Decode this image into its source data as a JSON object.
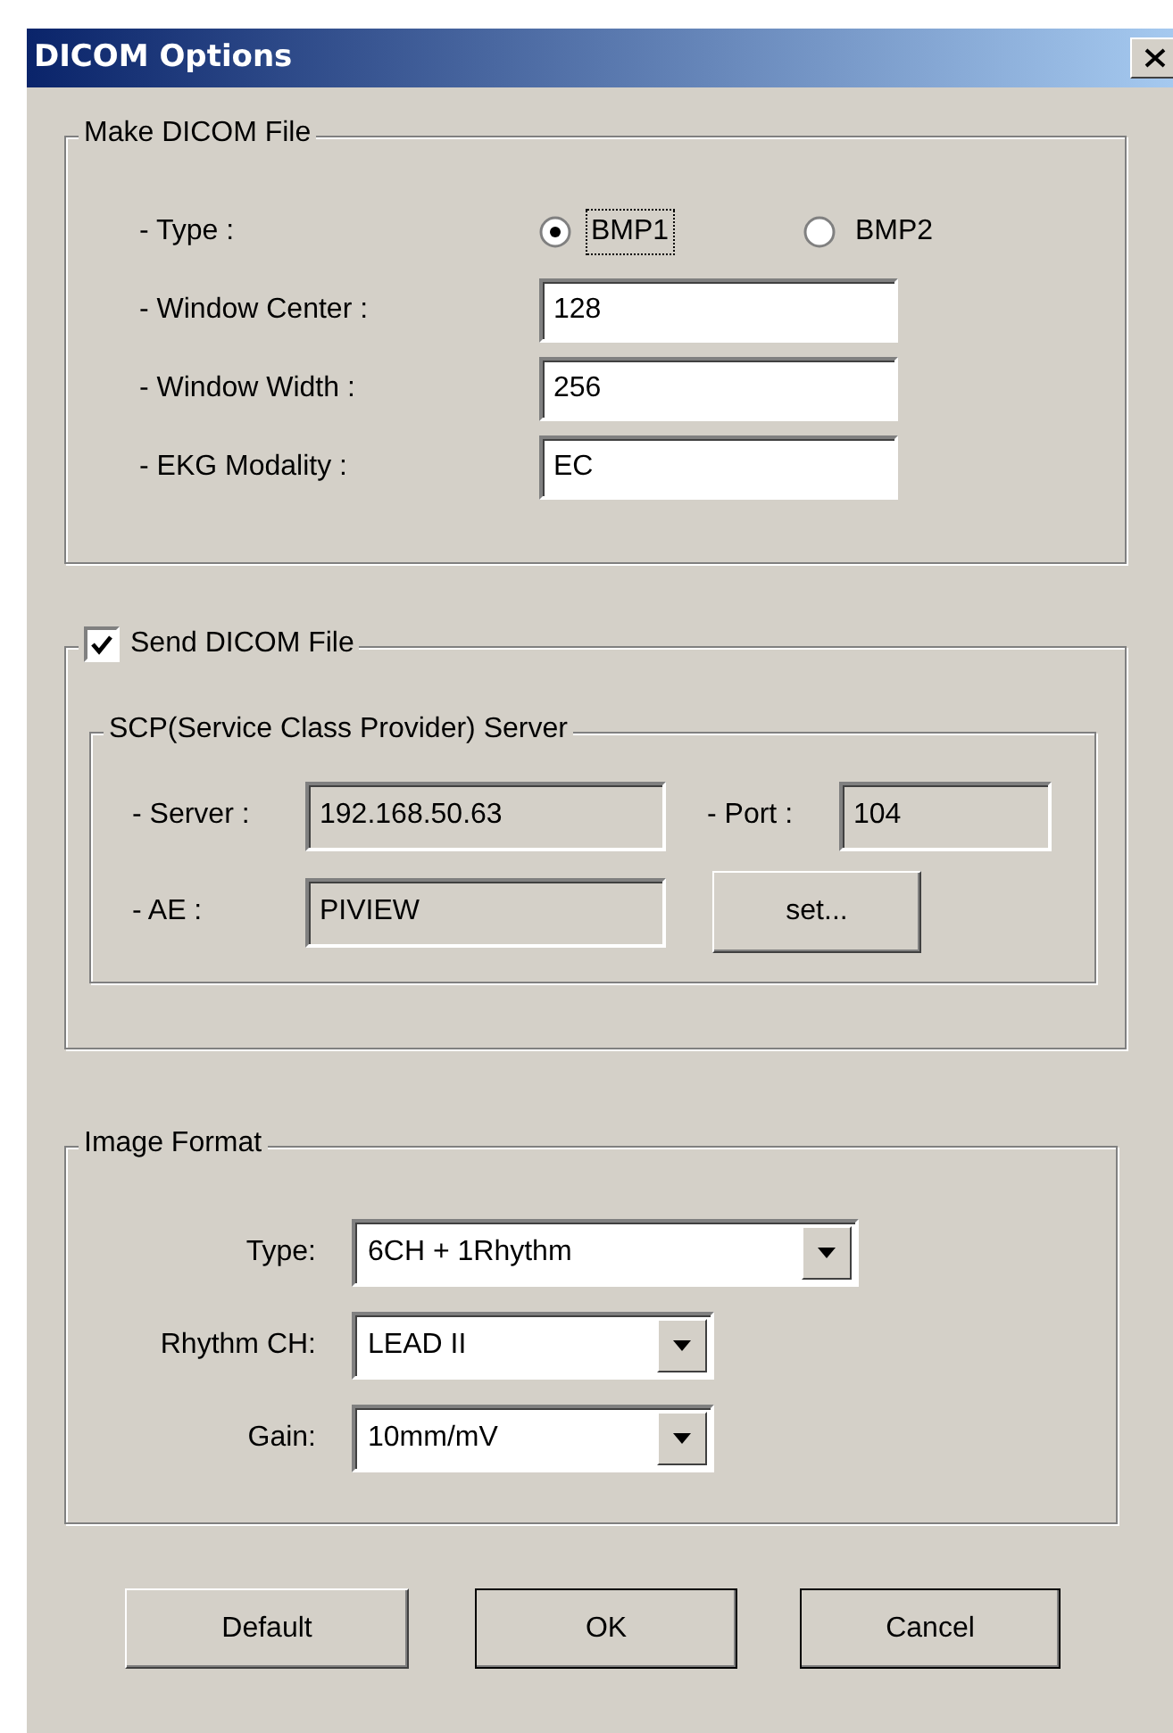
{
  "window": {
    "title": "DICOM Options"
  },
  "make_dicom_file": {
    "title": "Make DICOM File",
    "type": {
      "label": "- Type :",
      "options": [
        {
          "label": "BMP1",
          "selected": true,
          "focused": true
        },
        {
          "label": "BMP2",
          "selected": false,
          "focused": false
        }
      ]
    },
    "fields": [
      {
        "label": "- Window Center :",
        "value": "128",
        "readonly": false
      },
      {
        "label": "- Window Width :",
        "value": "256",
        "readonly": false
      },
      {
        "label": "- EKG Modality :",
        "value": "EC",
        "readonly": false
      }
    ]
  },
  "send_dicom_file": {
    "label": "Send DICOM File",
    "checked": true,
    "server_group": {
      "title": "SCP(Service Class Provider) Server",
      "server": {
        "label": "- Server :",
        "value": "192.168.50.63",
        "readonly": true
      },
      "port": {
        "label": "- Port :",
        "value": "104",
        "readonly": true
      },
      "ae": {
        "label": "- AE :",
        "value": "PIVIEW",
        "readonly": true
      },
      "set_button": "set..."
    }
  },
  "image_format": {
    "title": "Image Format",
    "selects": [
      {
        "label": "Type:",
        "value": "6CH + 1Rhythm"
      },
      {
        "label": "Rhythm CH:",
        "value": "LEAD II"
      },
      {
        "label": "Gain:",
        "value": "10mm/mV"
      }
    ]
  },
  "buttons": [
    {
      "label": "Default"
    },
    {
      "label": "OK"
    },
    {
      "label": "Cancel"
    }
  ]
}
